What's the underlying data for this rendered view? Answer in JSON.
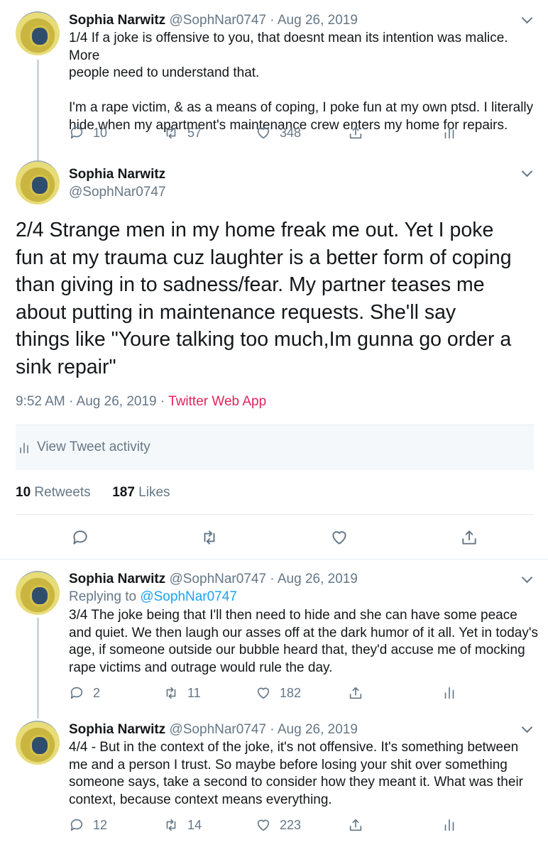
{
  "tweets": [
    {
      "name": "Sophia Narwitz",
      "handle": "@SophNar0747",
      "date": "Aug 26, 2019",
      "text_1": "1/4 If a joke is offensive to you, that doesnt mean its intention was malice. More",
      "text_2": "people need to understand that.",
      "text_3": "I'm a rape victim, & as a means of coping, I poke fun at my own ptsd. I literally",
      "text_4": "hide when my apartment's maintenance crew enters my home for repairs.",
      "replies": "10",
      "retweets": "57",
      "likes": "348"
    },
    {
      "name": "Sophia Narwitz",
      "handle": "@SophNar0747",
      "lines": [
        "2/4 Strange men in my home freak me out. Yet I poke",
        "fun at my trauma cuz laughter is a better form of coping",
        "than giving in to sadness/fear. My partner teases me",
        "about putting in maintenance requests. She'll say",
        "things like \"Youre talking too much,Im gunna go order a",
        "sink repair\""
      ],
      "time": "9:52 AM · Aug 26, 2019 ·",
      "source": "Twitter Web App",
      "activity": "View Tweet activity",
      "retweets_count": "10",
      "retweets_label": "Retweets",
      "likes_count": "187",
      "likes_label": "Likes"
    },
    {
      "name": "Sophia Narwitz",
      "handle": "@SophNar0747",
      "date": "Aug 26, 2019",
      "replying_prefix": "Replying to",
      "replying_to": "@SophNar0747",
      "lines": [
        "3/4 The joke being that I'll then need to hide and she can have some peace",
        "and quiet. We then laugh our asses off at the dark humor of it all. Yet in today's",
        "age, if someone outside our bubble heard that, they'd accuse me of mocking",
        "rape victims and outrage would rule the day."
      ],
      "replies": "2",
      "retweets": "11",
      "likes": "182"
    },
    {
      "name": "Sophia Narwitz",
      "handle": "@SophNar0747",
      "date": "Aug 26, 2019",
      "lines": [
        "4/4 - But in the context of the joke, it's not offensive. It's something between",
        "me and a person I trust. So maybe before losing your shit over something",
        "someone says, take a second to consider how they meant it. What was their",
        "context, because context means everything."
      ],
      "replies": "12",
      "retweets": "14",
      "likes": "223"
    }
  ],
  "separator": "·"
}
